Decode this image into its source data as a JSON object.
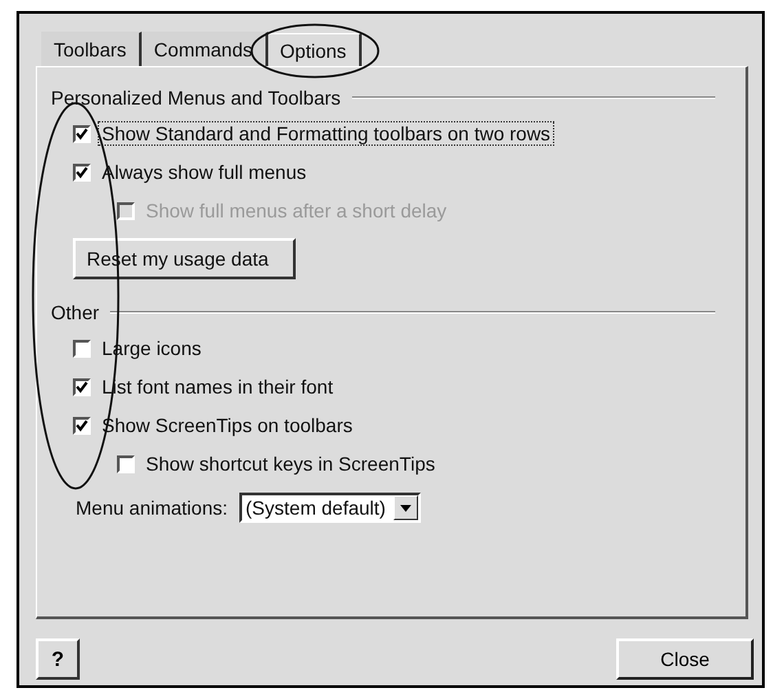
{
  "tabs": [
    {
      "label": "Toolbars",
      "selected": false
    },
    {
      "label": "Commands",
      "selected": false
    },
    {
      "label": "Options",
      "selected": true
    }
  ],
  "groups": [
    {
      "title": "Personalized Menus and Toolbars",
      "items": [
        {
          "kind": "checkbox",
          "label": "Show Standard and Formatting toolbars on two rows",
          "checked": true,
          "disabled": false,
          "focused": true,
          "indented": false
        },
        {
          "kind": "checkbox",
          "label": "Always show full menus",
          "checked": true,
          "disabled": false,
          "focused": false,
          "indented": false
        },
        {
          "kind": "checkbox",
          "label": "Show full menus after a short delay",
          "checked": false,
          "disabled": true,
          "focused": false,
          "indented": true
        },
        {
          "kind": "button",
          "label": "Reset my usage data"
        }
      ]
    },
    {
      "title": "Other",
      "items": [
        {
          "kind": "checkbox",
          "label": "Large icons",
          "checked": false,
          "disabled": false,
          "focused": false,
          "indented": false
        },
        {
          "kind": "checkbox",
          "label": "List font names in their font",
          "checked": true,
          "disabled": false,
          "focused": false,
          "indented": false
        },
        {
          "kind": "checkbox",
          "label": "Show ScreenTips on toolbars",
          "checked": true,
          "disabled": false,
          "focused": false,
          "indented": false
        },
        {
          "kind": "checkbox",
          "label": "Show shortcut keys in ScreenTips",
          "checked": false,
          "disabled": false,
          "focused": false,
          "indented": true
        },
        {
          "kind": "dropdown",
          "label": "Menu animations:",
          "value": "(System default)"
        }
      ]
    }
  ],
  "footer": {
    "help": "?",
    "close": "Close"
  }
}
